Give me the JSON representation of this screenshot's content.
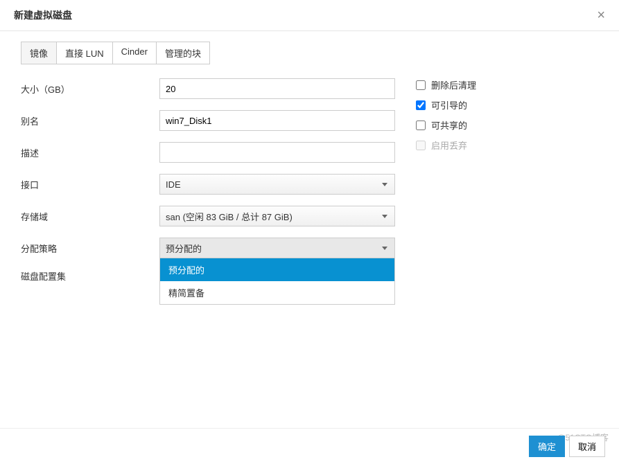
{
  "dialog": {
    "title": "新建虚拟磁盘",
    "close_symbol": "×"
  },
  "tabs": [
    {
      "label": "镜像",
      "active": true
    },
    {
      "label": "直接 LUN",
      "active": false
    },
    {
      "label": "Cinder",
      "active": false
    },
    {
      "label": "管理的块",
      "active": false
    }
  ],
  "fields": {
    "size": {
      "label": "大小（GB）",
      "value": "20"
    },
    "alias": {
      "label": "别名",
      "value": "win7_Disk1"
    },
    "description": {
      "label": "描述",
      "value": ""
    },
    "interface": {
      "label": "接口",
      "value": "IDE"
    },
    "storage_domain": {
      "label": "存储域",
      "value": "san (空闲 83 GiB / 总计 87 GiB)"
    },
    "allocation_policy": {
      "label": "分配策略",
      "value": "预分配的"
    },
    "disk_profile": {
      "label": "磁盘配置集",
      "value": ""
    }
  },
  "allocation_options": [
    {
      "label": "预分配的",
      "selected": true
    },
    {
      "label": "精简置备",
      "selected": false
    }
  ],
  "checkboxes": {
    "wipe_after_delete": {
      "label": "删除后清理",
      "checked": false,
      "disabled": false
    },
    "bootable": {
      "label": "可引导的",
      "checked": true,
      "disabled": false
    },
    "shareable": {
      "label": "可共享的",
      "checked": false,
      "disabled": false
    },
    "enable_discard": {
      "label": "启用丢弃",
      "checked": false,
      "disabled": true
    }
  },
  "footer": {
    "ok": "确定",
    "cancel": "取消"
  },
  "watermark": "@51CTO博客"
}
